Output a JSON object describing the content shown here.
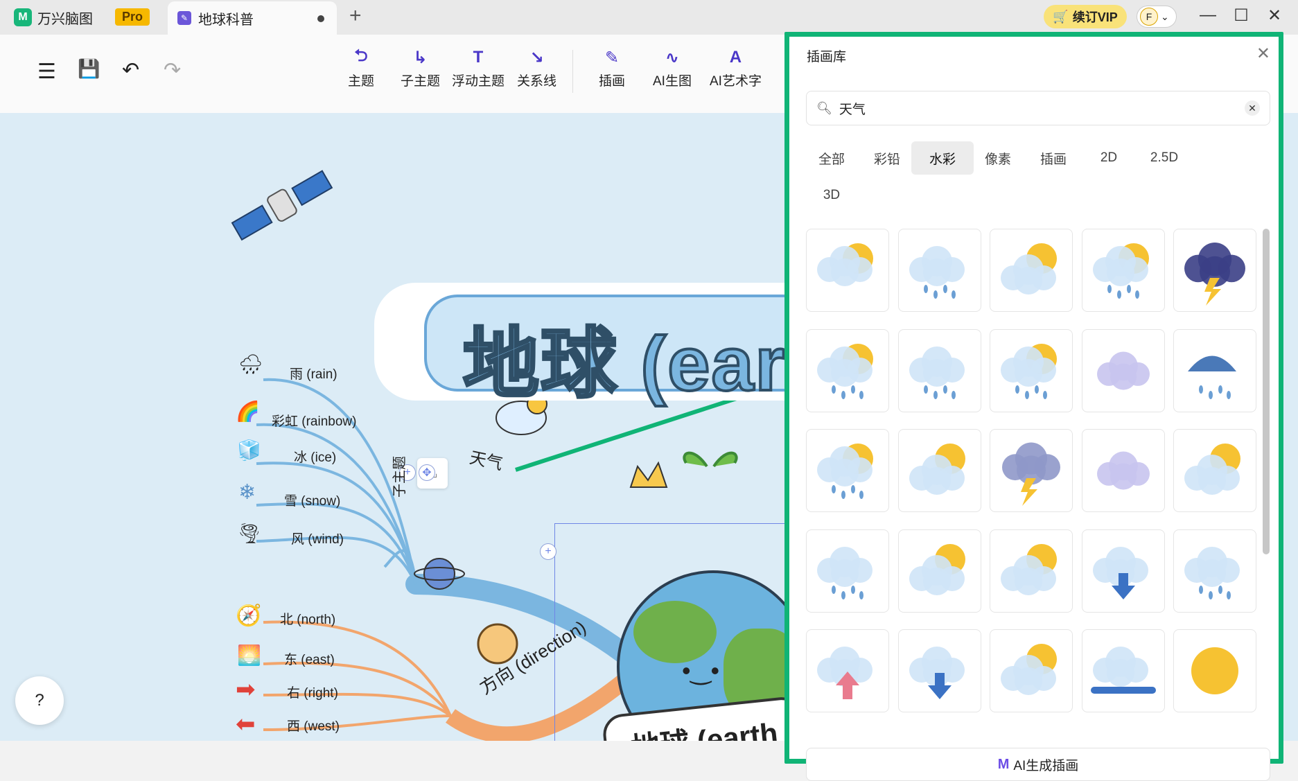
{
  "titlebar": {
    "app_name": "万兴脑图",
    "pro_badge": "Pro",
    "doc_tab": "地球科普",
    "new_tab": "+",
    "vip_label": "续订VIP",
    "avatar_letter": "F",
    "win_minimize": "—",
    "win_maximize": "☐",
    "win_close": "✕"
  },
  "toolbar": {
    "menu_icon": "☰",
    "save_icon": "💾",
    "undo_icon": "↶",
    "redo_icon": "↷",
    "tools": [
      {
        "label": "主题",
        "icon": "⮌"
      },
      {
        "label": "子主题",
        "icon": "↳"
      },
      {
        "label": "浮动主题",
        "icon": "T"
      },
      {
        "label": "关系线",
        "icon": "↘"
      },
      {
        "label": "插画",
        "icon": "✎"
      },
      {
        "label": "AI生图",
        "icon": "∿"
      },
      {
        "label": "AI艺术字",
        "icon": "A"
      }
    ]
  },
  "canvas": {
    "banner_text": "地球 (eart",
    "central_text": "地球 (earth",
    "weather_branch": "天气",
    "subtopic_label": "子主题",
    "direction_branch": "方向 (direction)",
    "weather_items": [
      "雨 (rain)",
      "彩虹 (rainbow)",
      "冰 (ice)",
      "雪 (snow)",
      "风 (wind)"
    ],
    "direction_items": [
      "北 (north)",
      "东 (east)",
      "右 (right)",
      "西 (west)"
    ],
    "help": "?"
  },
  "panel": {
    "title": "插画库",
    "close": "✕",
    "search_value": "天气",
    "search_clear": "✕",
    "filters": [
      "全部",
      "彩铅",
      "水彩",
      "像素",
      "插画",
      "2D",
      "2.5D",
      "3D"
    ],
    "active_filter": "水彩",
    "ai_button": "AI生成插画",
    "ai_icon": "M"
  },
  "illustrations": [
    "sun-behind-cloud-icon",
    "rain-cloud-icon",
    "sun-cloud-icon",
    "sun-rain-cloud-icon",
    "thunderstorm-cloud-icon",
    "sun-rain-cloud-icon",
    "rain-cloud-icon",
    "sun-rain-cloud-icon",
    "wind-swirl-icon",
    "umbrella-rain-icon",
    "sun-rain-cloud-icon",
    "sun-clouds-icon",
    "lightning-cloud-icon",
    "wind-cloud-icon",
    "sun-clouds-icon",
    "rain-cloud-icon",
    "sun-clouds-icon",
    "sun-cloud-icon",
    "download-cloud-icon",
    "rain-cloud-icon",
    "upload-cloud-icon",
    "download-cloud-icon",
    "sun-cloud-icon",
    "progress-cloud-icon",
    "sun-icon"
  ],
  "colors": {
    "accent_green": "#10b476",
    "brand_purple": "#4a37c8",
    "canvas_bg": "#dcecf6",
    "weather_branch": "#7bb6e0",
    "direction_branch": "#f2a56c",
    "vip_yellow": "#f9e279"
  }
}
